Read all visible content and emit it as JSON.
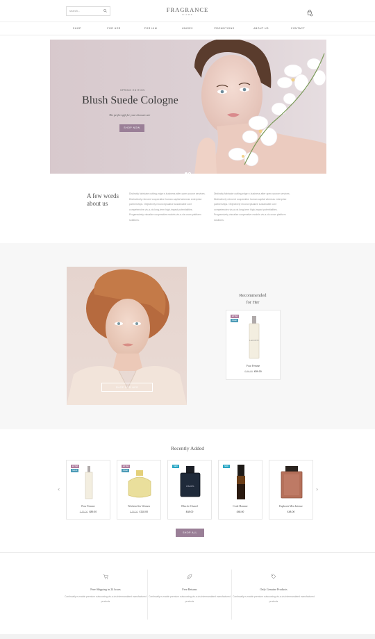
{
  "header": {
    "search_placeholder": "search...",
    "logo": "FRAGRANCE",
    "logo_sub": "NICHE"
  },
  "nav": [
    "SHOP",
    "FOR HER",
    "FOR HIM",
    "UNISEX",
    "PROMOTIONS",
    "ABOUT US",
    "CONTACT"
  ],
  "hero": {
    "kicker": "SPRING EDITION",
    "title": "Blush Suede Cologne",
    "subtitle": "The perfect gift for your choosen one",
    "button": "SHOP NOW"
  },
  "about": {
    "heading_line1": "A few words",
    "heading_line2": "about us",
    "col1": "Distinctly fabricate cutting-edge e-business after open-source services. Distinctively reinvent cooperative human capital whereas enterprise partnerships. Objectively reconceptualize sustainable core competencies vis-a-vis long-term high-impact potentialities. Progressively visualize cooperative models vis-a-vis cross platform solutions.",
    "col2": "Distinctly fabricate cutting-edge e-business after open-source services. Distinctively reinvent cooperative human capital whereas enterprise partnerships. Objectively reconceptualize sustainable core competencies vis-a-vis long-term high-impact potentialities. Progressively visualize cooperative models vis-a-vis cross platform solutions."
  },
  "recommended": {
    "title_line1": "Recommended",
    "title_line2": "for Her",
    "image_button": "SHOP FOR HER",
    "product": {
      "badges": [
        "EXTRA",
        "SALE!"
      ],
      "name": "Pour Femme",
      "old_price": "£ 56.00",
      "price": "£89.00"
    }
  },
  "recently": {
    "title": "Recently Added",
    "shop_all": "SHOP ALL",
    "products": [
      {
        "name": "Pour Femme",
        "old_price": "£ 56.00",
        "price": "£89.00",
        "badges": [
          "EXTRA",
          "SALE!"
        ]
      },
      {
        "name": "Weekend for Women",
        "old_price": "£ 56.00",
        "price": "£118.00",
        "badges": [
          "EXTRA",
          "SALE!"
        ]
      },
      {
        "name": "Bleu de Chanel",
        "old_price": "",
        "price": "£48.00",
        "badges": [
          "NEW"
        ]
      },
      {
        "name": "Code Homme",
        "old_price": "",
        "price": "£48.00",
        "badges": [
          "NEW"
        ]
      },
      {
        "name": "Euphoria Men Intense",
        "old_price": "",
        "price": "£48.00",
        "badges": []
      }
    ]
  },
  "features": [
    {
      "title": "Free Shipping in 24 hours",
      "text": "Continually e-enable premium outsourcing vis-a-vis intermandated manufactured products"
    },
    {
      "title": "Free Returns",
      "text": "Continually e-enable premium outsourcing vis-a-vis intermandated manufactured products"
    },
    {
      "title": "Only Genuine Products",
      "text": "Continually e-enable premium outsourcing vis-a-vis intermandated manufactured products"
    }
  ],
  "colors": {
    "accent": "#9a7f97",
    "badge_sale": "#4b9bb7",
    "badge_extra": "#b07fa0",
    "badge_new": "#29a6c4"
  }
}
